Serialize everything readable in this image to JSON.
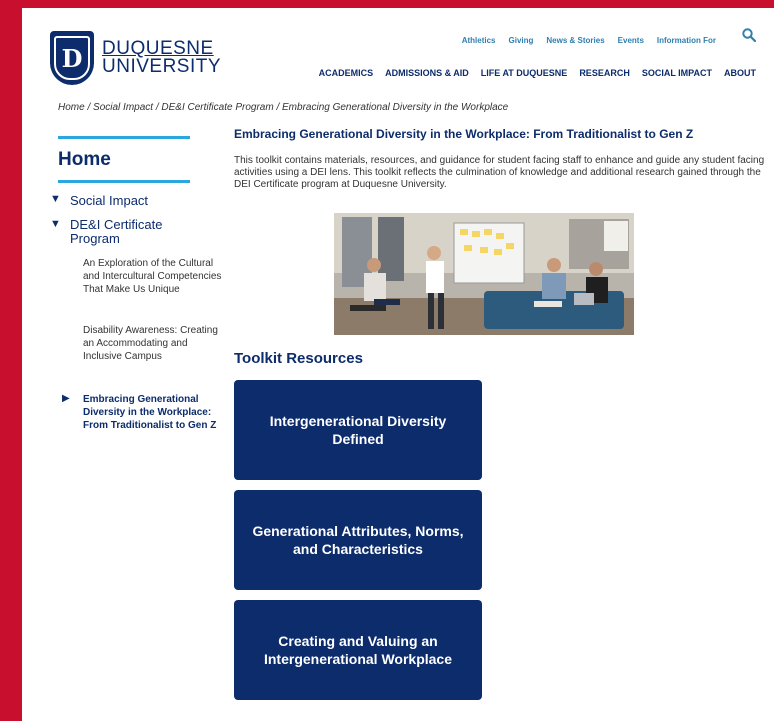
{
  "header": {
    "logo_line1": "DUQUESNE",
    "logo_line2": "UNIVERSITY",
    "logo_mark": "D",
    "top_links": [
      "Athletics",
      "Giving",
      "News & Stories",
      "Events",
      "Information For"
    ],
    "main_links": [
      "ACADEMICS",
      "ADMISSIONS & AID",
      "LIFE AT DUQUESNE",
      "RESEARCH",
      "SOCIAL IMPACT",
      "ABOUT"
    ],
    "search_icon": "search-icon"
  },
  "breadcrumb": [
    "Home",
    "Social Impact",
    "DE&I Certificate Program",
    "Embracing Generational Diversity in the Workplace"
  ],
  "sidebar": {
    "home": "Home",
    "social_impact": "Social Impact",
    "dei_program": "DE&I Certificate Program",
    "sub_items": [
      "An Exploration of the Cultural and Intercultural Competencies That Make Us Unique",
      "Disability Awareness: Creating an Accommodating and Inclusive Campus",
      "Embracing Generational Diversity in the Workplace: From Traditionalist to Gen Z"
    ]
  },
  "main": {
    "title": "Embracing Generational Diversity in the Workplace: From Traditionalist to Gen Z",
    "intro": "This toolkit contains materials, resources, and guidance for student facing staff to enhance and guide any student facing activities using a DEI lens. This toolkit reflects the culmination of knowledge and additional research gained through the DEI Certificate program at Duquesne University.",
    "toolkit_heading": "Toolkit Resources",
    "cards": [
      "Intergenerational Diversity Defined",
      "Generational Attributes, Norms, and Characteristics",
      "Creating and Valuing an Intergenerational Workplace"
    ]
  },
  "colors": {
    "frame_red": "#c8102e",
    "navy": "#0d2c6c",
    "accent_blue": "#2aa7df",
    "link_blue": "#2f7fb0"
  }
}
